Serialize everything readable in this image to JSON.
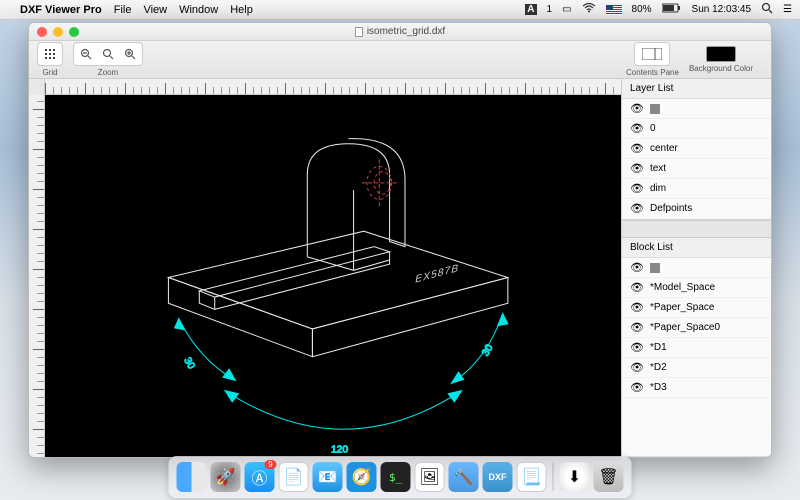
{
  "menubar": {
    "app_name": "DXF Viewer Pro",
    "items": [
      "File",
      "View",
      "Window",
      "Help"
    ],
    "ai_indicator": "1",
    "battery": "80%",
    "clock": "Sun 12:03:45"
  },
  "window": {
    "title": "isometric_grid.dxf"
  },
  "toolbar": {
    "grid_label": "Grid",
    "zoom_label": "Zoom",
    "contents_pane_label": "Contents Pane",
    "bg_color_label": "Background Color"
  },
  "drawing": {
    "part_label": "EX587B",
    "dim_left": "30",
    "dim_right": "30",
    "dim_bottom": "120"
  },
  "layer_panel": {
    "title": "Layer List",
    "items": [
      "0",
      "center",
      "text",
      "dim",
      "Defpoints"
    ]
  },
  "block_panel": {
    "title": "Block List",
    "items": [
      "*Model_Space",
      "*Paper_Space",
      "*Paper_Space0",
      "*D1",
      "*D2",
      "*D3"
    ]
  },
  "dock": {
    "appstore_badge": "9",
    "dxf_label": "DXF"
  }
}
